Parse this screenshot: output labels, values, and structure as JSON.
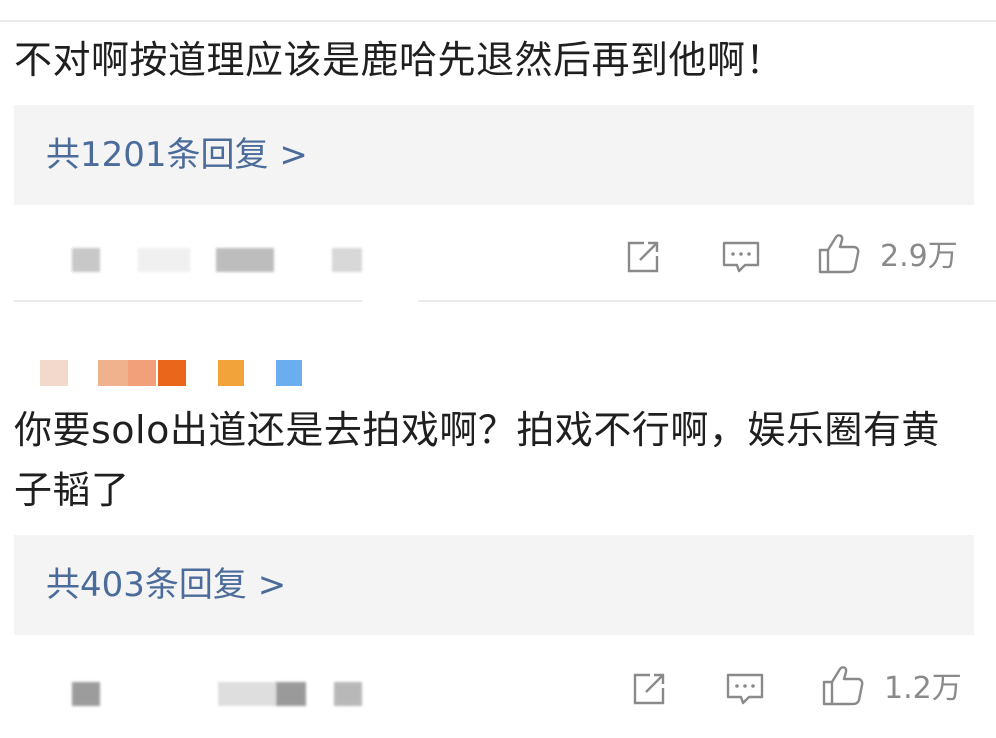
{
  "comments": [
    {
      "text": "不对啊按道理应该是鹿哈先退然后再到他啊！",
      "reply_label": "共1201条回复 >",
      "like_count": "2.9万",
      "icons": [
        "share-icon",
        "comment-icon",
        "like-icon"
      ]
    },
    {
      "text": "你要solo出道还是去拍戏啊？拍戏不行啊，娱乐圈有黄子韬了",
      "reply_label": "共403条回复 >",
      "like_count": "1.2万",
      "icons": [
        "share-icon",
        "comment-icon",
        "like-icon"
      ]
    }
  ],
  "colors": {
    "link": "#4b6b9a",
    "reply_bg": "#f4f4f4",
    "meta": "#8a8a8a",
    "avatar_swatches": [
      "#f3d8cc",
      "#f0b28c",
      "#f2a07a",
      "#e9661a",
      "#f2a43a",
      "#6aaef0"
    ]
  }
}
